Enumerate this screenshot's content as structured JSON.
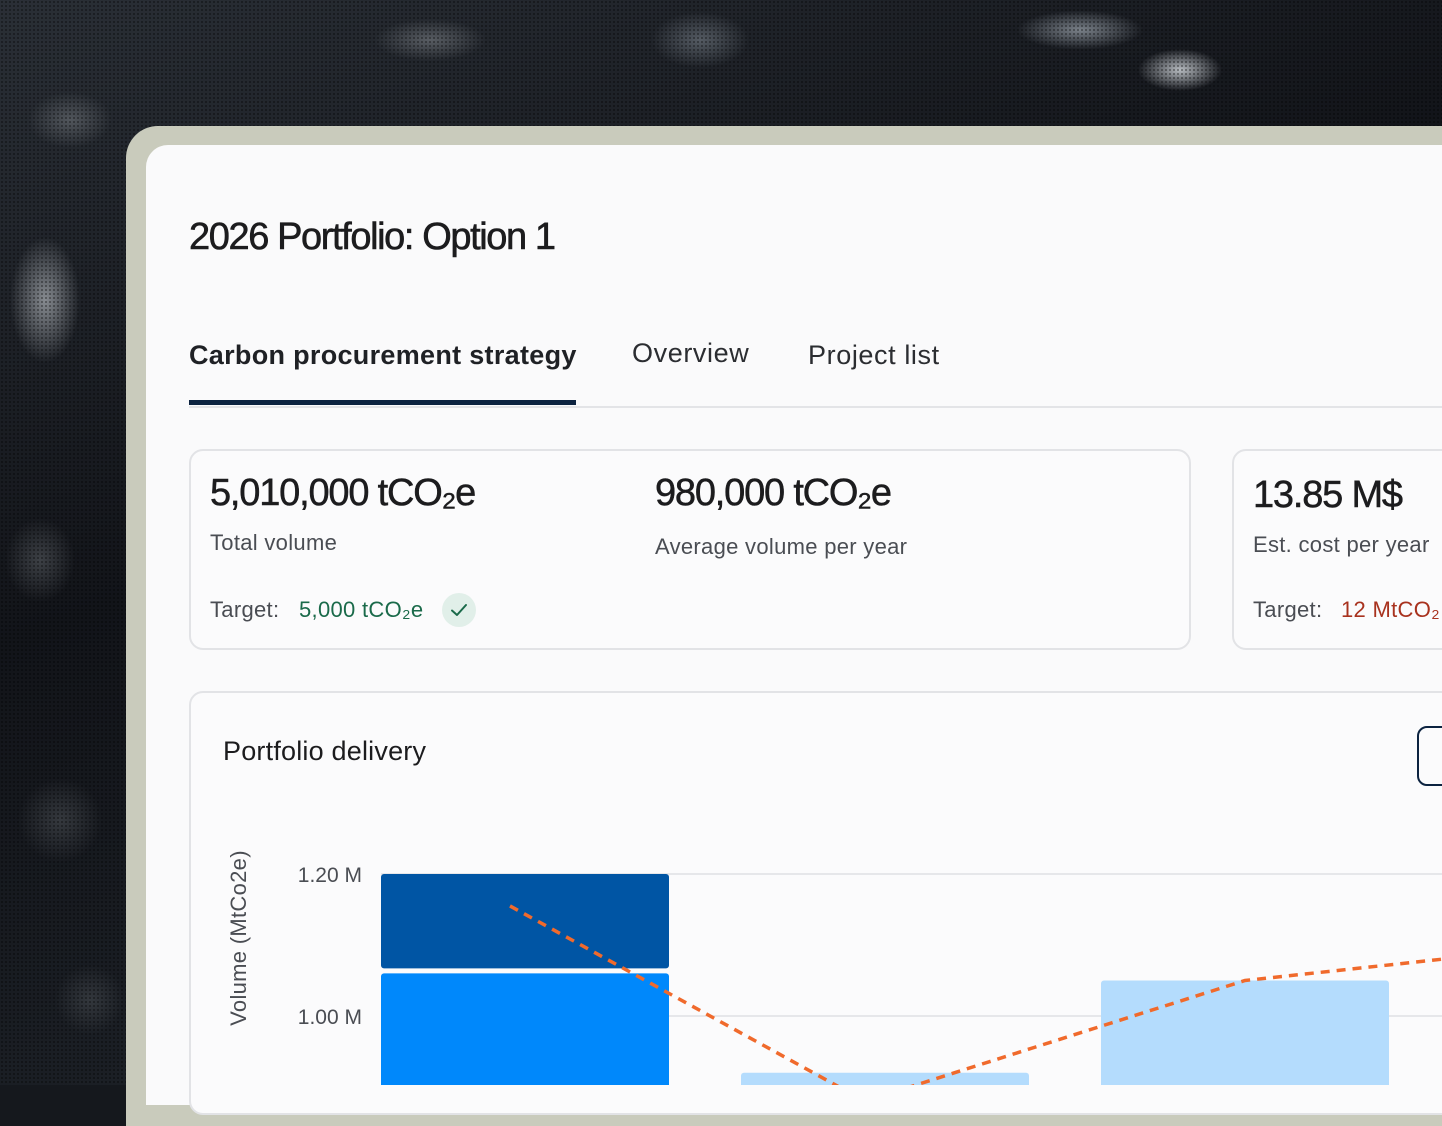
{
  "page_title": "2026 Portfolio: Option 1",
  "tabs": [
    {
      "label": "Carbon procurement strategy",
      "active": true
    },
    {
      "label": "Overview",
      "active": false
    },
    {
      "label": "Project list",
      "active": false
    }
  ],
  "stats_card_1": {
    "total_volume": {
      "value": "5,010,000 tCO₂e",
      "label": "Total volume"
    },
    "avg_volume": {
      "value": "980,000 tCO₂e",
      "label": "Average volume per year"
    },
    "target_label": "Target:",
    "target_value": "5,000 tCO₂e",
    "target_status_icon": "check-icon",
    "target_color": "#1a6a4a"
  },
  "stats_card_2": {
    "cost": {
      "value": "13.85 M$",
      "label": "Est. cost per year"
    },
    "target_label": "Target:",
    "target_value": "12 MtCO₂",
    "target_color": "#a8321e"
  },
  "chart": {
    "title": "Portfolio delivery",
    "ylabel": "Volume (MtCo2e)",
    "colors": {
      "dark": "#0055a4",
      "bright": "#0088fb",
      "light": "#b4dcfd",
      "trend": "#f06a2c",
      "grid": "#e6e7ea"
    }
  },
  "chart_data": {
    "type": "bar",
    "ylabel": "Volume (MtCo2e)",
    "yticks": [
      "1.20 M",
      "1.00 M"
    ],
    "tick_values": [
      1.2,
      1.0
    ],
    "bars": [
      {
        "segments": [
          {
            "value": 1.06,
            "color": "#0088fb"
          },
          {
            "value": 0.14,
            "color": "#0055a4"
          }
        ],
        "top": 1.2
      },
      {
        "segments": [
          {
            "value": 0.92,
            "color": "#b4dcfd"
          }
        ],
        "top": 0.92
      },
      {
        "segments": [
          {
            "value": 1.05,
            "color": "#b4dcfd"
          }
        ],
        "top": 1.05
      }
    ],
    "trend_line": {
      "style": "dashed",
      "color": "#f06a2c",
      "values": [
        1.155,
        0.88,
        1.05,
        1.08
      ]
    }
  }
}
